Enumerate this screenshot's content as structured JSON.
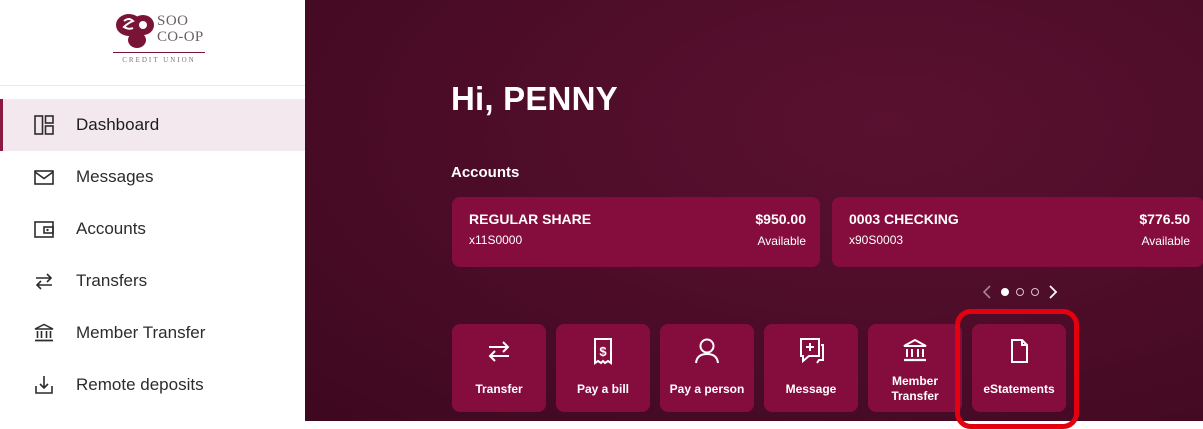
{
  "brand": {
    "logo_line1": "SOO",
    "logo_line2": "CO-OP",
    "logo_line3": "CREDIT UNION",
    "primary_color": "#850d3d",
    "background_color": "#4b0c27",
    "highlight_color": "#e3000f"
  },
  "sidebar": {
    "items": [
      {
        "label": "Dashboard",
        "icon": "dashboard-icon",
        "active": true
      },
      {
        "label": "Messages",
        "icon": "envelope-icon"
      },
      {
        "label": "Accounts",
        "icon": "wallet-icon"
      },
      {
        "label": "Transfers",
        "icon": "transfer-arrows-icon"
      },
      {
        "label": "Member Transfer",
        "icon": "bank-icon"
      },
      {
        "label": "Remote deposits",
        "icon": "deposit-icon"
      }
    ]
  },
  "main": {
    "greeting": "Hi, PENNY",
    "accounts_title": "Accounts",
    "accounts": [
      {
        "name": "REGULAR SHARE",
        "number": "x11S0000",
        "balance": "$950.00",
        "status": "Available"
      },
      {
        "name": "0003 CHECKING",
        "number": "x90S0003",
        "balance": "$776.50",
        "status": "Available"
      }
    ],
    "pager": {
      "pages": 3,
      "active": 1
    },
    "actions": [
      {
        "label": "Transfer",
        "icon": "transfer-icon"
      },
      {
        "label": "Pay a bill",
        "icon": "bill-icon"
      },
      {
        "label": "Pay a person",
        "icon": "person-icon"
      },
      {
        "label": "Message",
        "icon": "message-icon"
      },
      {
        "label": "Member Transfer",
        "icon": "bank-icon"
      },
      {
        "label": "eStatements",
        "icon": "document-icon",
        "highlighted": true
      }
    ]
  }
}
